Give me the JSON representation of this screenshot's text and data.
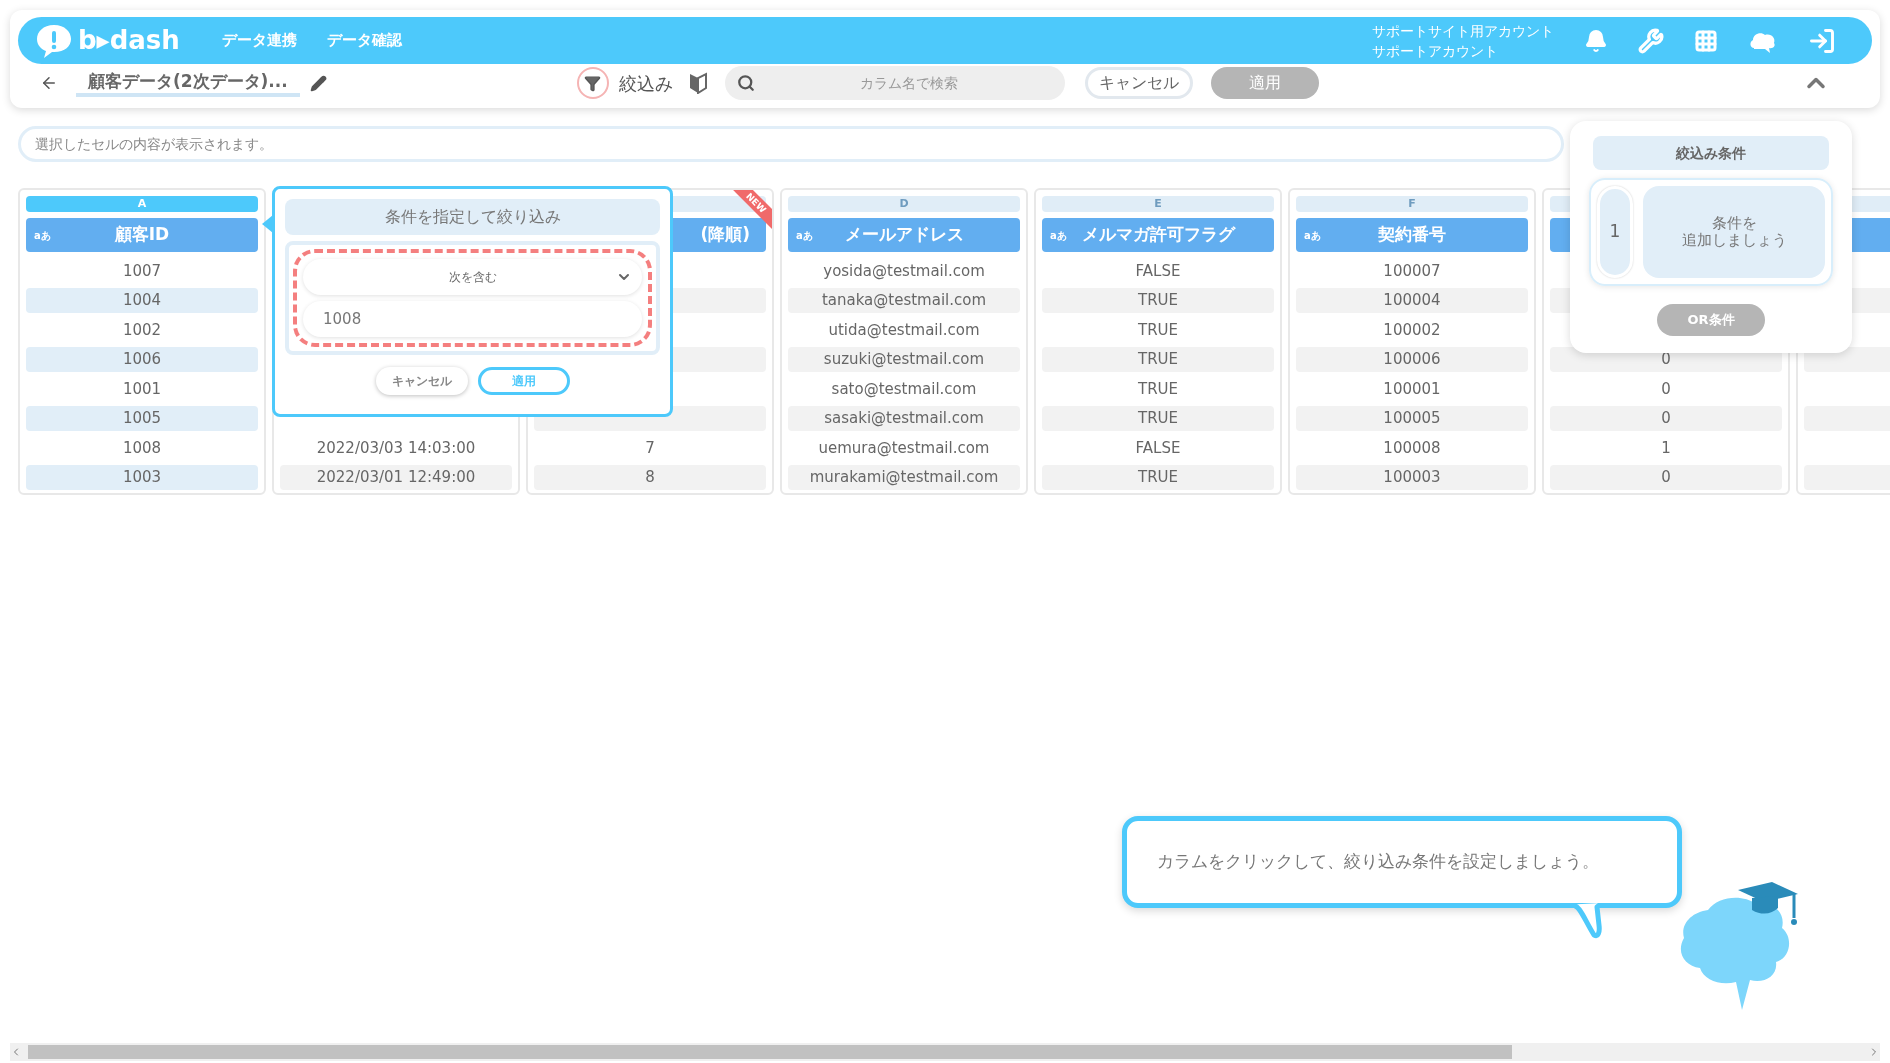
{
  "header": {
    "logo_text": "b▸dash",
    "nav": [
      {
        "label": "データ連携"
      },
      {
        "label": "データ確認"
      }
    ],
    "account": [
      "サポートサイト用アカウント",
      "サポートアカウント"
    ]
  },
  "toolbar": {
    "title": "顧客データ(2次データ)...",
    "filter_label": "絞込み",
    "search": {
      "placeholder": "カラム名で検索"
    },
    "buttons": [
      {
        "label": "キャンセル",
        "disabled": false
      },
      {
        "label": "適用",
        "disabled": true
      }
    ]
  },
  "cell_viewer": {
    "placeholder": "選択したセルの内容が表示されます。"
  },
  "columns": [
    {
      "letter": "A",
      "type_badge": "aあ",
      "title": "顧客ID",
      "selected": true,
      "cells": [
        "1007",
        "1004",
        "1002",
        "1006",
        "1001",
        "1005",
        "1008",
        "1003"
      ]
    },
    {
      "selected": false,
      "covered": true,
      "cells": [
        "2022/03/03 14:03:00",
        "2022/03/01 12:49:00"
      ]
    },
    {
      "title": "(降順)",
      "selected": false,
      "new": true,
      "new_label": "NEW",
      "cells": [
        "7",
        "8"
      ]
    },
    {
      "letter": "D",
      "type_badge": "aあ",
      "title": "メールアドレス",
      "selected": false,
      "cells": [
        "yosida@testmail.com",
        "tanaka@testmail.com",
        "utida@testmail.com",
        "suzuki@testmail.com",
        "sato@testmail.com",
        "sasaki@testmail.com",
        "uemura@testmail.com",
        "murakami@testmail.com"
      ]
    },
    {
      "letter": "E",
      "type_badge": "aあ",
      "title": "メルマガ許可フラグ",
      "selected": false,
      "cells": [
        "FALSE",
        "TRUE",
        "TRUE",
        "TRUE",
        "TRUE",
        "TRUE",
        "FALSE",
        "TRUE"
      ]
    },
    {
      "letter": "F",
      "type_badge": "aあ",
      "title": "契約番号",
      "selected": false,
      "cells": [
        "100007",
        "100004",
        "100002",
        "100006",
        "100001",
        "100005",
        "100008",
        "100003"
      ]
    },
    {
      "selected": false,
      "cells": [
        "0",
        "0",
        "0",
        "1",
        "0"
      ]
    },
    {
      "selected": false
    }
  ],
  "filter_popup": {
    "title": "条件を指定して絞り込み",
    "condition": "次を含む",
    "value": "1008",
    "buttons": [
      {
        "label": "キャンセル",
        "primary": false
      },
      {
        "label": "適用",
        "primary": true
      }
    ]
  },
  "conditions_panel": {
    "title": "絞込み条件",
    "conditions": [
      {
        "index": "1",
        "lines": [
          "条件を",
          "追加しましょう"
        ]
      }
    ],
    "or_button": {
      "label": "OR条件",
      "disabled": true
    }
  },
  "hint": {
    "text": "カラムをクリックして、絞り込み条件を設定しましょう。"
  }
}
